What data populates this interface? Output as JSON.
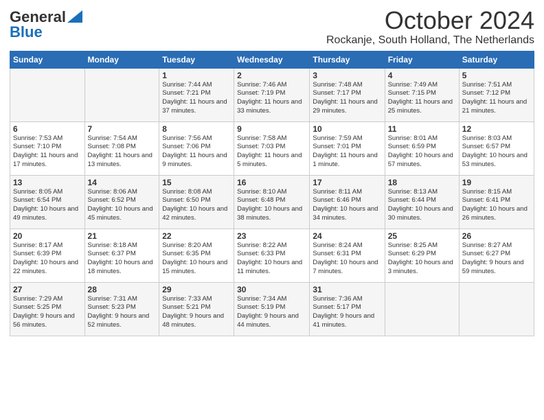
{
  "header": {
    "logo_general": "General",
    "logo_blue": "Blue",
    "month": "October 2024",
    "location": "Rockanje, South Holland, The Netherlands"
  },
  "days_of_week": [
    "Sunday",
    "Monday",
    "Tuesday",
    "Wednesday",
    "Thursday",
    "Friday",
    "Saturday"
  ],
  "weeks": [
    [
      {
        "day": "",
        "info": ""
      },
      {
        "day": "",
        "info": ""
      },
      {
        "day": "1",
        "info": "Sunrise: 7:44 AM\nSunset: 7:21 PM\nDaylight: 11 hours\nand 37 minutes."
      },
      {
        "day": "2",
        "info": "Sunrise: 7:46 AM\nSunset: 7:19 PM\nDaylight: 11 hours\nand 33 minutes."
      },
      {
        "day": "3",
        "info": "Sunrise: 7:48 AM\nSunset: 7:17 PM\nDaylight: 11 hours\nand 29 minutes."
      },
      {
        "day": "4",
        "info": "Sunrise: 7:49 AM\nSunset: 7:15 PM\nDaylight: 11 hours\nand 25 minutes."
      },
      {
        "day": "5",
        "info": "Sunrise: 7:51 AM\nSunset: 7:12 PM\nDaylight: 11 hours\nand 21 minutes."
      }
    ],
    [
      {
        "day": "6",
        "info": "Sunrise: 7:53 AM\nSunset: 7:10 PM\nDaylight: 11 hours\nand 17 minutes."
      },
      {
        "day": "7",
        "info": "Sunrise: 7:54 AM\nSunset: 7:08 PM\nDaylight: 11 hours\nand 13 minutes."
      },
      {
        "day": "8",
        "info": "Sunrise: 7:56 AM\nSunset: 7:06 PM\nDaylight: 11 hours\nand 9 minutes."
      },
      {
        "day": "9",
        "info": "Sunrise: 7:58 AM\nSunset: 7:03 PM\nDaylight: 11 hours\nand 5 minutes."
      },
      {
        "day": "10",
        "info": "Sunrise: 7:59 AM\nSunset: 7:01 PM\nDaylight: 11 hours\nand 1 minute."
      },
      {
        "day": "11",
        "info": "Sunrise: 8:01 AM\nSunset: 6:59 PM\nDaylight: 10 hours\nand 57 minutes."
      },
      {
        "day": "12",
        "info": "Sunrise: 8:03 AM\nSunset: 6:57 PM\nDaylight: 10 hours\nand 53 minutes."
      }
    ],
    [
      {
        "day": "13",
        "info": "Sunrise: 8:05 AM\nSunset: 6:54 PM\nDaylight: 10 hours\nand 49 minutes."
      },
      {
        "day": "14",
        "info": "Sunrise: 8:06 AM\nSunset: 6:52 PM\nDaylight: 10 hours\nand 45 minutes."
      },
      {
        "day": "15",
        "info": "Sunrise: 8:08 AM\nSunset: 6:50 PM\nDaylight: 10 hours\nand 42 minutes."
      },
      {
        "day": "16",
        "info": "Sunrise: 8:10 AM\nSunset: 6:48 PM\nDaylight: 10 hours\nand 38 minutes."
      },
      {
        "day": "17",
        "info": "Sunrise: 8:11 AM\nSunset: 6:46 PM\nDaylight: 10 hours\nand 34 minutes."
      },
      {
        "day": "18",
        "info": "Sunrise: 8:13 AM\nSunset: 6:44 PM\nDaylight: 10 hours\nand 30 minutes."
      },
      {
        "day": "19",
        "info": "Sunrise: 8:15 AM\nSunset: 6:41 PM\nDaylight: 10 hours\nand 26 minutes."
      }
    ],
    [
      {
        "day": "20",
        "info": "Sunrise: 8:17 AM\nSunset: 6:39 PM\nDaylight: 10 hours\nand 22 minutes."
      },
      {
        "day": "21",
        "info": "Sunrise: 8:18 AM\nSunset: 6:37 PM\nDaylight: 10 hours\nand 18 minutes."
      },
      {
        "day": "22",
        "info": "Sunrise: 8:20 AM\nSunset: 6:35 PM\nDaylight: 10 hours\nand 15 minutes."
      },
      {
        "day": "23",
        "info": "Sunrise: 8:22 AM\nSunset: 6:33 PM\nDaylight: 10 hours\nand 11 minutes."
      },
      {
        "day": "24",
        "info": "Sunrise: 8:24 AM\nSunset: 6:31 PM\nDaylight: 10 hours\nand 7 minutes."
      },
      {
        "day": "25",
        "info": "Sunrise: 8:25 AM\nSunset: 6:29 PM\nDaylight: 10 hours\nand 3 minutes."
      },
      {
        "day": "26",
        "info": "Sunrise: 8:27 AM\nSunset: 6:27 PM\nDaylight: 9 hours\nand 59 minutes."
      }
    ],
    [
      {
        "day": "27",
        "info": "Sunrise: 7:29 AM\nSunset: 5:25 PM\nDaylight: 9 hours\nand 56 minutes."
      },
      {
        "day": "28",
        "info": "Sunrise: 7:31 AM\nSunset: 5:23 PM\nDaylight: 9 hours\nand 52 minutes."
      },
      {
        "day": "29",
        "info": "Sunrise: 7:33 AM\nSunset: 5:21 PM\nDaylight: 9 hours\nand 48 minutes."
      },
      {
        "day": "30",
        "info": "Sunrise: 7:34 AM\nSunset: 5:19 PM\nDaylight: 9 hours\nand 44 minutes."
      },
      {
        "day": "31",
        "info": "Sunrise: 7:36 AM\nSunset: 5:17 PM\nDaylight: 9 hours\nand 41 minutes."
      },
      {
        "day": "",
        "info": ""
      },
      {
        "day": "",
        "info": ""
      }
    ]
  ]
}
